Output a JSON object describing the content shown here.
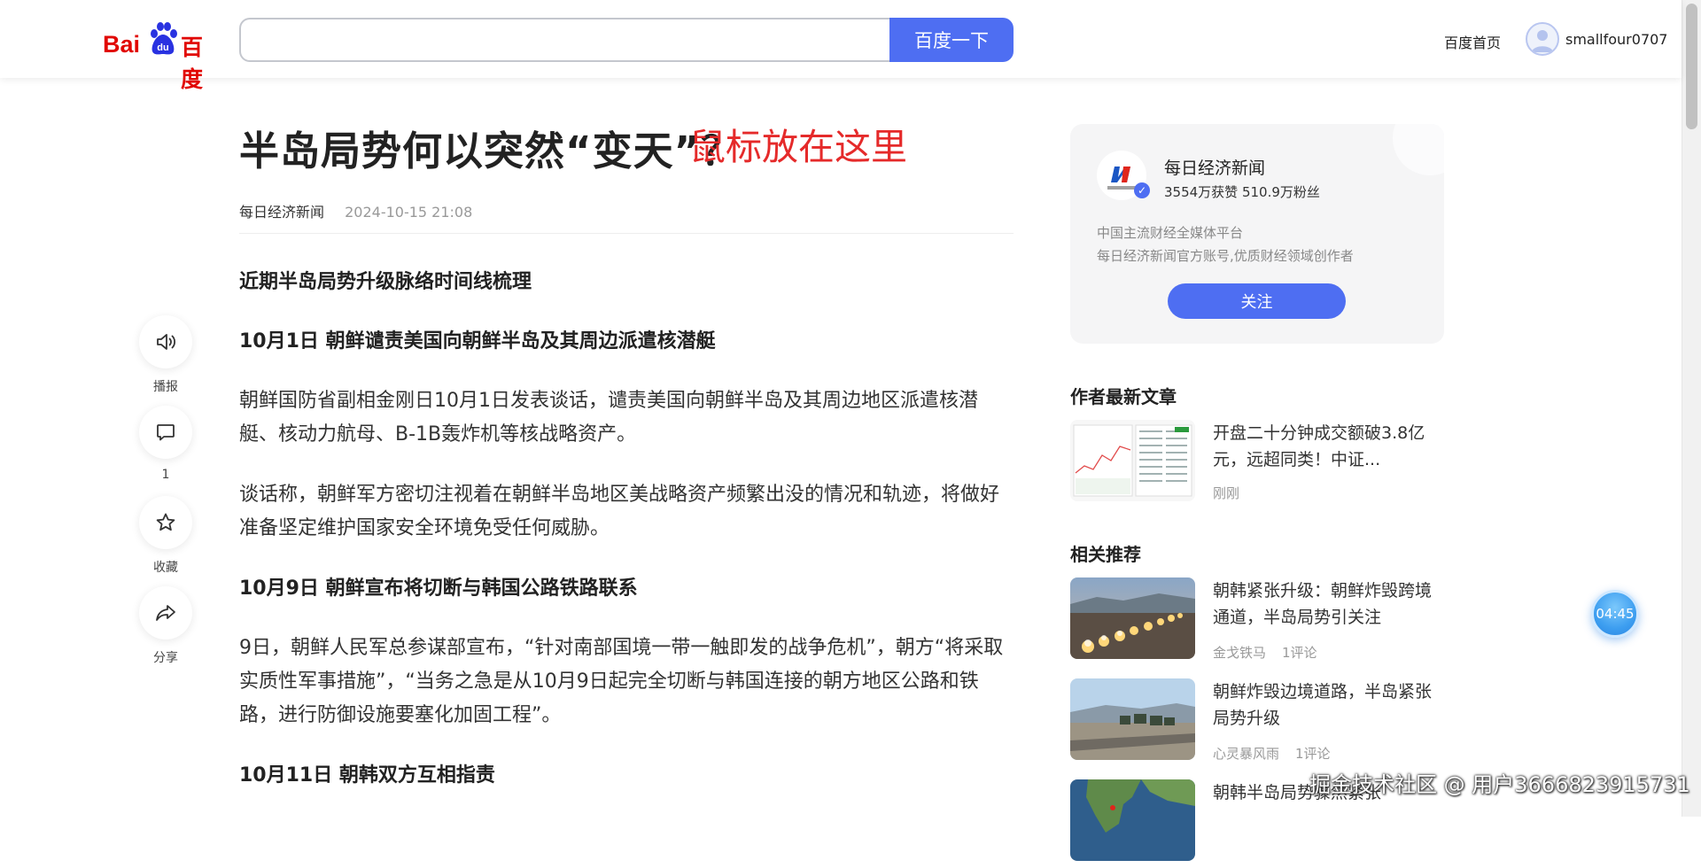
{
  "header": {
    "logo_bai": "Bai",
    "logo_du": "du",
    "logo_text": "百度",
    "search_value": "",
    "search_button": "百度一下",
    "home_link": "百度首页",
    "username": "smallfour0707"
  },
  "article": {
    "title": "半岛局势何以突然“变天”？",
    "overlay_note": "鼠标放在这里",
    "source": "每日经济新闻",
    "date": "2024-10-15 21:08",
    "paragraphs": [
      "近期半岛局势升级脉络时间线梳理",
      "10月1日 朝鲜谴责美国向朝鲜半岛及其周边派遣核潜艇",
      "朝鲜国防省副相金刚日10月1日发表谈话，谴责美国向朝鲜半岛及其周边地区派遣核潜艇、核动力航母、B-1B轰炸机等核战略资产。",
      "谈话称，朝鲜军方密切注视着在朝鲜半岛地区美战略资产频繁出没的情况和轨迹，将做好准备坚定维护国家安全环境免受任何威胁。",
      "10月9日 朝鲜宣布将切断与韩国公路铁路联系",
      "9日，朝鲜人民军总参谋部宣布，“针对南部国境一带一触即发的战争危机”，朝方“将采取实质性军事措施”，“当务之急是从10月9日起完全切断与韩国连接的朝方地区公路和铁路，进行防御设施要塞化加固工程”。",
      "10月11日 朝韩双方互相指责"
    ]
  },
  "actions": {
    "broadcast": "播报",
    "comment_count": "1",
    "favorite": "收藏",
    "share": "分享"
  },
  "author": {
    "name": "每日经济新闻",
    "stats": "3554万获赞 510.9万粉丝",
    "desc_line1": "中国主流财经全媒体平台",
    "desc_line2": "每日经济新闻官方账号,优质财经领域创作者",
    "follow_button": "关注"
  },
  "latest": {
    "section_title": "作者最新文章",
    "items": [
      {
        "title": "开盘二十分钟成交额破3.8亿元，远超同类！中证...",
        "time": "刚刚"
      }
    ]
  },
  "related": {
    "section_title": "相关推荐",
    "items": [
      {
        "title": "朝韩紧张升级：朝鲜炸毁跨境通道，半岛局势引关注",
        "author": "金戈铁马",
        "comments": "1评论"
      },
      {
        "title": "朝鲜炸毁边境道路，半岛紧张局势升级",
        "author": "心灵暴风雨",
        "comments": "1评论"
      },
      {
        "title": "朝韩半岛局势骤然紧张"
      }
    ]
  },
  "timer": "04:45",
  "watermark": "掘金技术社区 @ 用户3666823915731",
  "colors": {
    "brand_blue": "#4e6ef2",
    "baidu_red": "#e10602",
    "overlay_red": "#e52a2a"
  }
}
